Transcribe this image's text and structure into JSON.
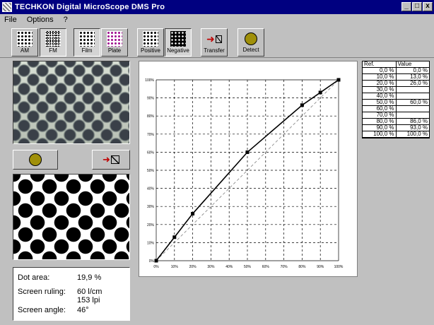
{
  "window": {
    "title": "TECHKON Digital MicroScope DMS Pro",
    "buttons": [
      "_",
      "□",
      "x"
    ]
  },
  "menu": [
    "File",
    "Options",
    "?"
  ],
  "toolbar": {
    "am": "AM",
    "fm": "FM",
    "film": "Film",
    "plate": "Plate",
    "positive": "Positive",
    "negative": "Negative",
    "transfer": "Transfer",
    "detect": "Detect"
  },
  "stats": {
    "dot_area_label": "Dot area:",
    "dot_area_value": "19,9 %",
    "ruling_label": "Screen ruling:",
    "ruling_value_1": "60 l/cm",
    "ruling_value_2": "153 lpi",
    "angle_label": "Screen angle:",
    "angle_value": "46°"
  },
  "table": {
    "headers": [
      "Ref.",
      "Value"
    ],
    "rows": [
      [
        "0,0 %",
        "0,0 %"
      ],
      [
        "10,0 %",
        "13,0 %"
      ],
      [
        "20,0 %",
        "26,0 %"
      ],
      [
        "30,0 %",
        ""
      ],
      [
        "40,0 %",
        ""
      ],
      [
        "50,0 %",
        "60,0 %"
      ],
      [
        "60,0 %",
        ""
      ],
      [
        "70,0 %",
        ""
      ],
      [
        "80,0 %",
        "86,0 %"
      ],
      [
        "90,0 %",
        "93,0 %"
      ],
      [
        "100,0 %",
        "100,0 %"
      ]
    ]
  },
  "chart_data": {
    "type": "line",
    "x_ticks": [
      "0%",
      "10%",
      "20%",
      "30%",
      "40%",
      "50%",
      "60%",
      "70%",
      "80%",
      "90%",
      "100%"
    ],
    "y_ticks": [
      "0%",
      "10%",
      "20%",
      "30%",
      "40%",
      "50%",
      "60%",
      "70%",
      "80%",
      "90%",
      "100%"
    ],
    "xlim": [
      0,
      100
    ],
    "ylim": [
      0,
      100
    ],
    "grid": true,
    "series": [
      {
        "x": [
          0,
          10,
          20,
          50,
          80,
          90,
          100
        ],
        "y": [
          0,
          13,
          26,
          60,
          86,
          93,
          100
        ],
        "style": "solid",
        "markers": true,
        "color": "#000000"
      },
      {
        "x": [
          0,
          100
        ],
        "y": [
          0,
          100
        ],
        "style": "dashed",
        "markers": false,
        "color": "#808080"
      }
    ]
  }
}
